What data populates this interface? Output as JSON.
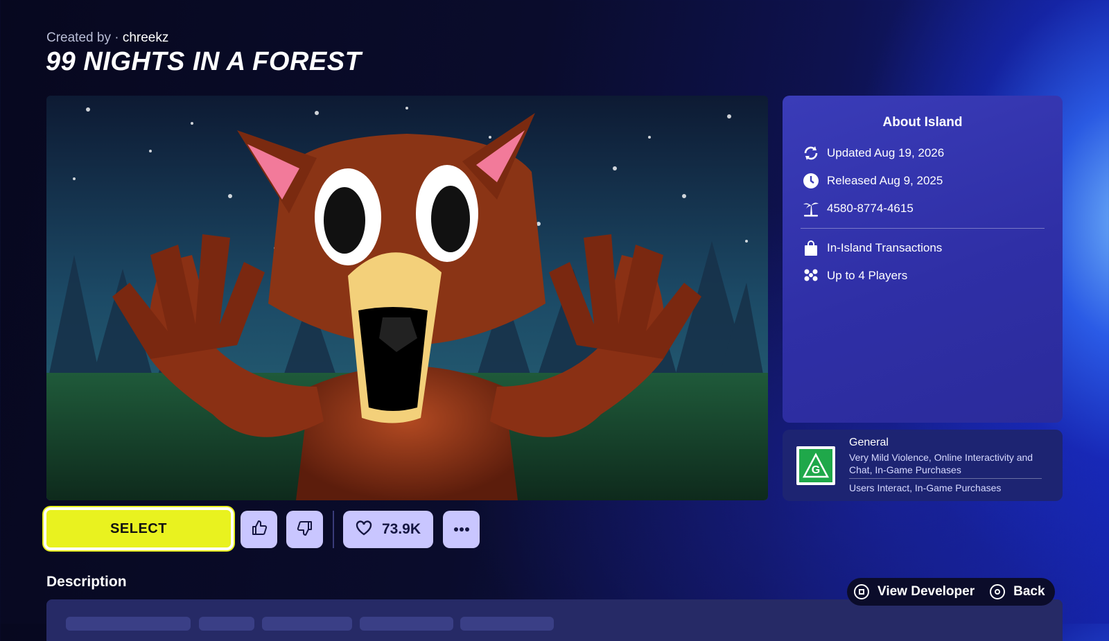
{
  "header": {
    "created_by_label": "Created by ·",
    "creator": "chreekz",
    "title": "99 NIGHTS IN A FOREST"
  },
  "about": {
    "title": "About Island",
    "updated": "Updated Aug 19, 2026",
    "released": "Released Aug 9, 2025",
    "island_code": "4580-8774-4615",
    "transactions": "In-Island Transactions",
    "players": "Up to 4 Players",
    "icons": [
      "refresh-icon",
      "clock-icon",
      "island-icon",
      "shopping-bag-icon",
      "players-icon"
    ]
  },
  "rating": {
    "badge_letter": "G",
    "title": "General",
    "descriptors": "Very Mild Violence, Online Interactivity and Chat, In-Game Purchases",
    "interactive": "Users Interact, In-Game Purchases"
  },
  "actions": {
    "select_label": "SELECT",
    "favorites_count": "73.9K"
  },
  "description": {
    "title": "Description"
  },
  "footer": {
    "view_developer": "View Developer",
    "back": "Back"
  },
  "colors": {
    "select_yellow": "#e9f21f",
    "pill_lavender": "#c9c6ff",
    "panel_blue": "#3a3cb8",
    "rating_green": "#1fa84a"
  }
}
